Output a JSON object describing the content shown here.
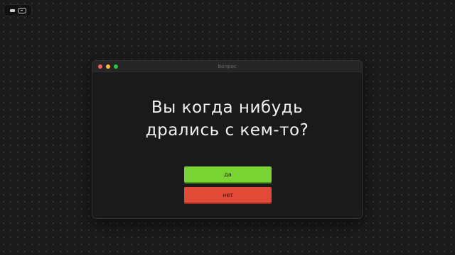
{
  "window": {
    "title": "Вопрос"
  },
  "question": {
    "line1": "Вы когда нибудь",
    "line2": "дрались с кем-то?"
  },
  "buttons": {
    "yes_label": "да",
    "no_label": "нет"
  },
  "colors": {
    "yes": "#79d332",
    "no": "#e04a36",
    "background": "#1b1b1b"
  }
}
